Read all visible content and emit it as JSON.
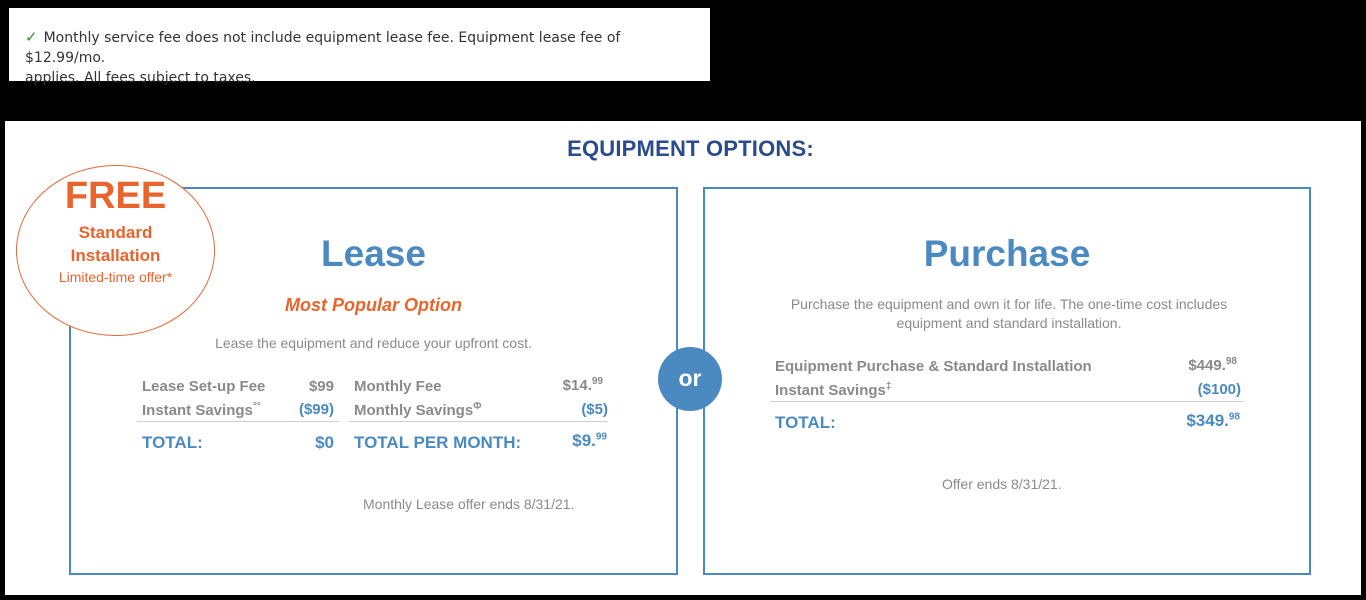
{
  "notice": {
    "text_line1": "Monthly service fee does not include equipment lease fee. Equipment lease fee of $12.99/mo.",
    "text_line2": "applies. All fees subject to taxes."
  },
  "heading": "EQUIPMENT OPTIONS:",
  "badge": {
    "free": "FREE",
    "line1": "Standard",
    "line2": "Installation",
    "limited": "Limited-time offer*"
  },
  "or_label": "or",
  "lease": {
    "title": "Lease",
    "popular": "Most Popular Option",
    "description": "Lease the equipment and reduce your upfront cost.",
    "left": {
      "setup_label": "Lease Set-up Fee",
      "setup_value": "$99",
      "savings_label": "Instant Savings",
      "savings_mark": "°°",
      "savings_value": "($99)",
      "total_label": "TOTAL:",
      "total_value": "$0"
    },
    "right": {
      "fee_label": "Monthly Fee",
      "fee_value_main": "$14.",
      "fee_value_cents": "99",
      "savings_label": "Monthly Savings",
      "savings_mark": "Φ",
      "savings_value": "($5)",
      "total_label": "TOTAL PER MONTH:",
      "total_value_main": "$9.",
      "total_value_cents": "99"
    },
    "offer": "Monthly Lease offer ends 8/31/21."
  },
  "purchase": {
    "title": "Purchase",
    "description": "Purchase the equipment and own it for life. The one-time cost includes equipment and standard installation.",
    "item_label": "Equipment Purchase & Standard Installation",
    "item_value_main": "$449.",
    "item_value_cents": "98",
    "savings_label": "Instant Savings",
    "savings_mark": "‡",
    "savings_value": "($100)",
    "total_label": "TOTAL:",
    "total_value_main": "$349.",
    "total_value_cents": "98",
    "offer": "Offer ends 8/31/21."
  },
  "colors": {
    "accent_blue": "#4a8ac0",
    "heading_navy": "#2b4c8c",
    "accent_orange": "#e8642c",
    "check_green": "#2e8b2e"
  },
  "icons": {
    "notice_icon": "checkmark-icon"
  }
}
